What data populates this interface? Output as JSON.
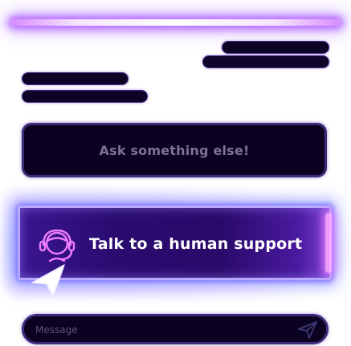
{
  "chat": {
    "ask_button_label": "Ask something else!",
    "human_button_label": "Talk to a human support"
  },
  "composer": {
    "placeholder": "Message",
    "send_icon": "send-icon"
  },
  "icons": {
    "agent": "headset-agent-icon",
    "cursor": "cursor-arrow-icon"
  },
  "colors": {
    "accent_glow": "#a03cff",
    "button_dark": "#0b0120",
    "support_gradient": "#3a1590",
    "muted_text": "#7b7393"
  }
}
